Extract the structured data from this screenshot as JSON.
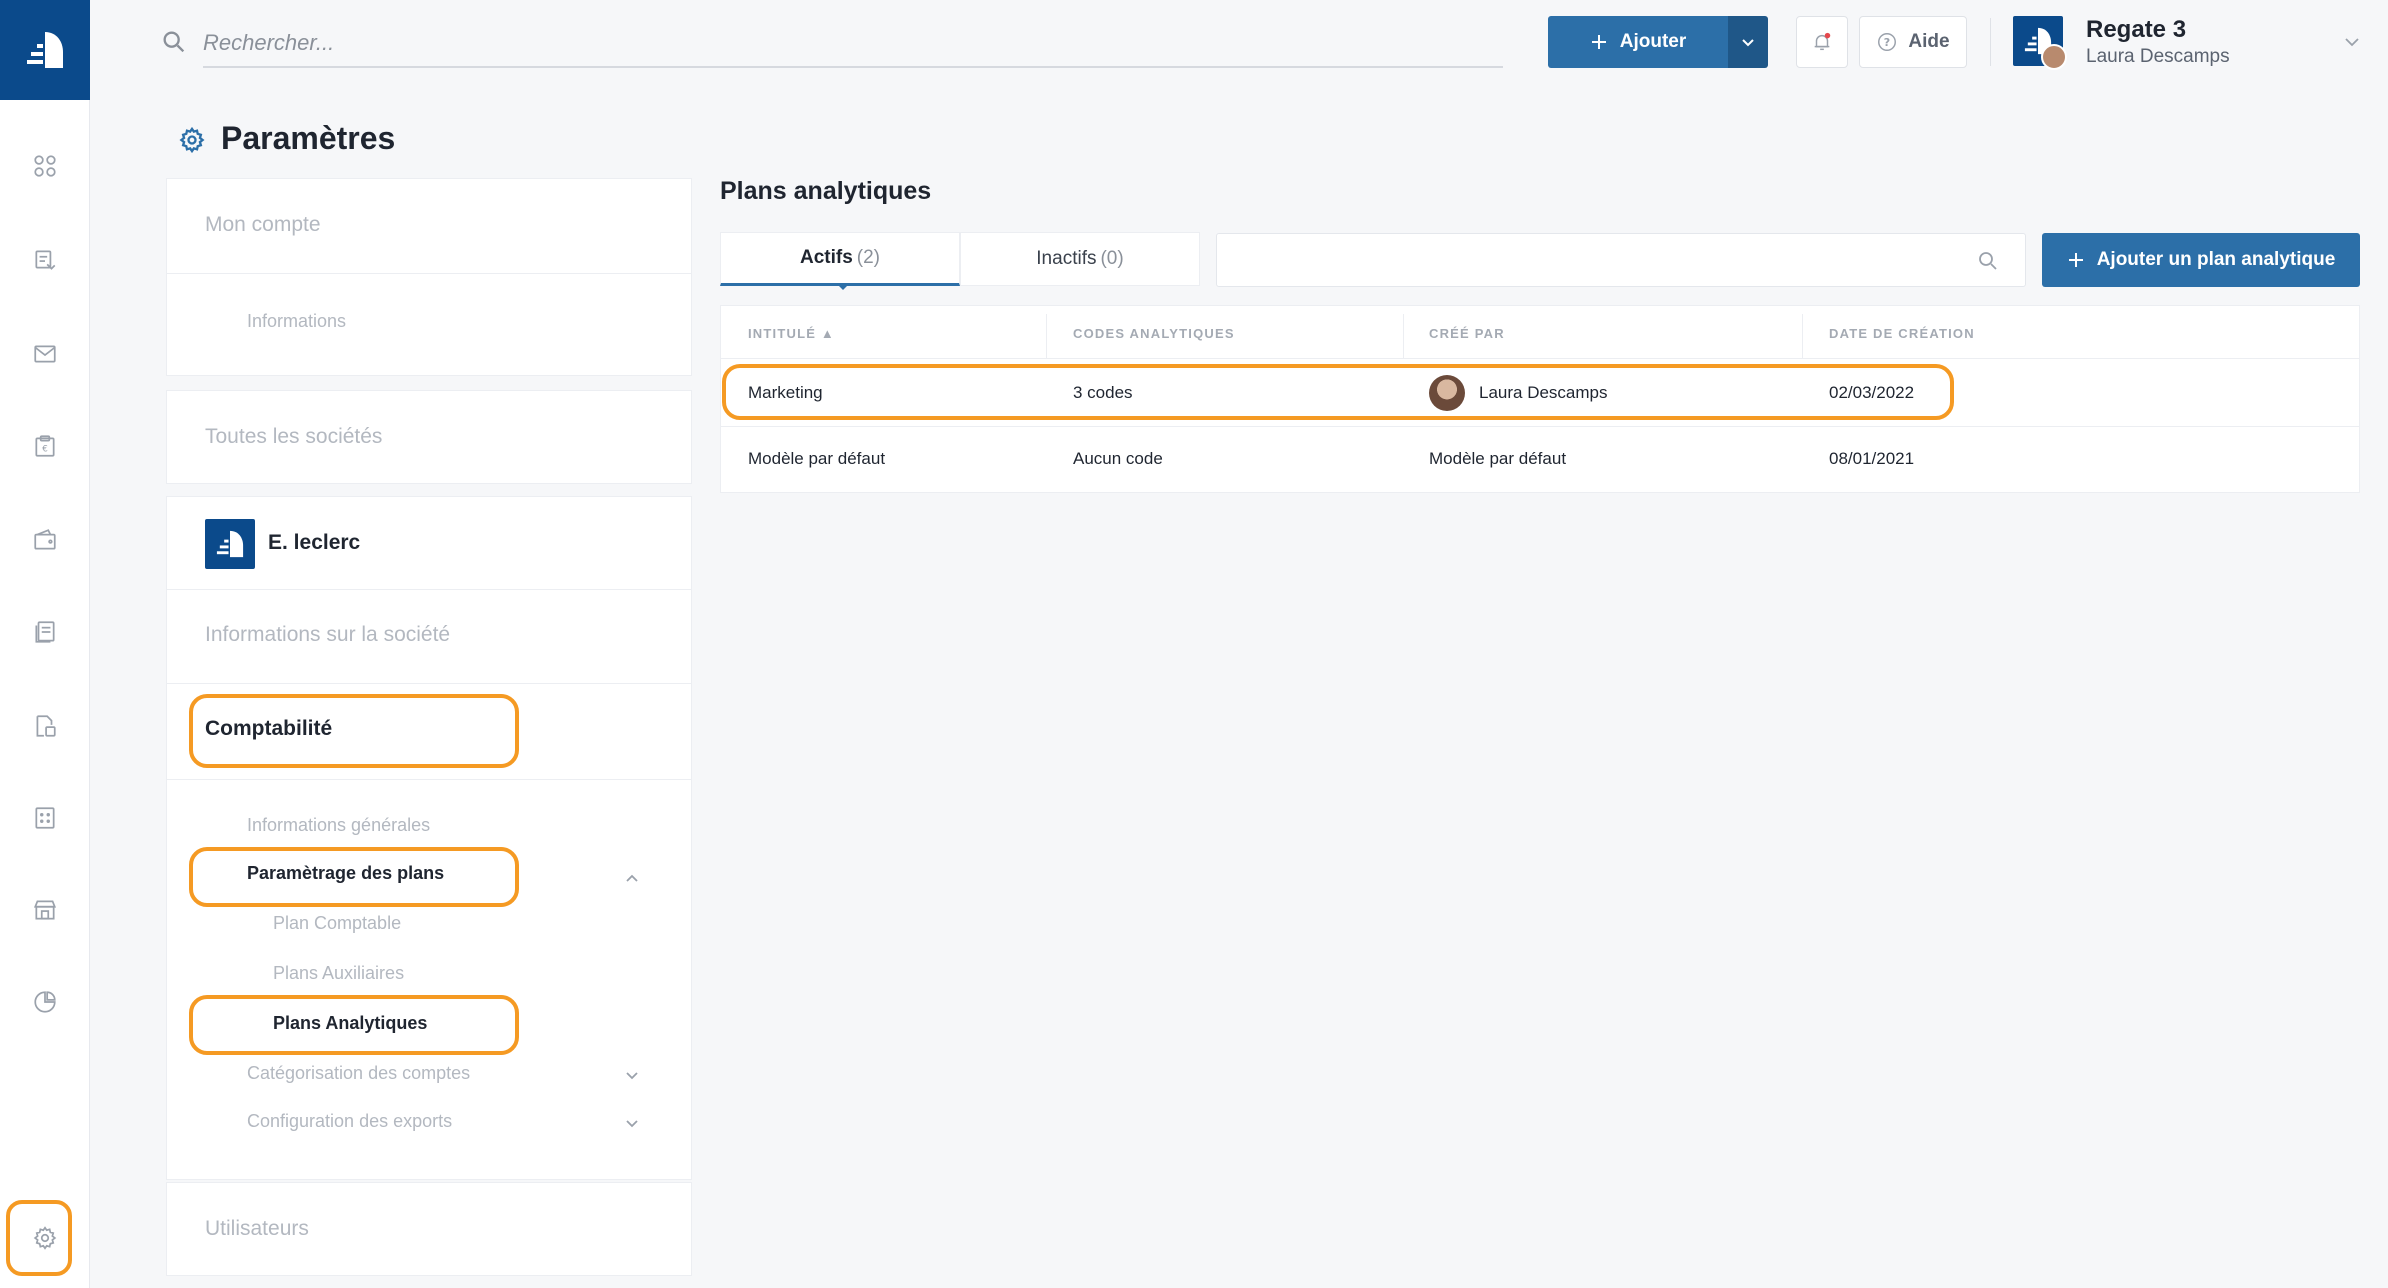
{
  "search": {
    "placeholder": "Rechercher..."
  },
  "header": {
    "add_label": "Ajouter",
    "help_label": "Aide",
    "company_name": "Regate 3",
    "user_name": "Laura Descamps"
  },
  "page": {
    "title": "Paramètres"
  },
  "sidebar": {
    "mon_compte": "Mon compte",
    "informations": "Informations",
    "toutes_societes": "Toutes les sociétés",
    "company": "E. leclerc",
    "infos_societe": "Informations sur la société",
    "comptabilite": "Comptabilité",
    "infos_generales": "Informations générales",
    "parametrage_plans": "Paramètrage des plans",
    "plan_comptable": "Plan Comptable",
    "plans_auxiliaires": "Plans Auxiliaires",
    "plans_analytiques": "Plans Analytiques",
    "categorisation": "Catégorisation des comptes",
    "configuration_exports": "Configuration des exports",
    "utilisateurs": "Utilisateurs"
  },
  "main": {
    "title": "Plans analytiques",
    "tabs": [
      {
        "label": "Actifs",
        "count": "(2)"
      },
      {
        "label": "Inactifs",
        "count": "(0)"
      }
    ],
    "add_plan_label": "Ajouter un plan analytique",
    "table": {
      "headers": [
        "INTITULÉ ▲",
        "CODES ANALYTIQUES",
        "CRÉÉ PAR",
        "DATE DE CRÉATION"
      ],
      "rows": [
        {
          "intitule": "Marketing",
          "codes": "3 codes",
          "cree_par": "Laura Descamps",
          "date": "02/03/2022"
        },
        {
          "intitule": "Modèle par défaut",
          "codes": "Aucun code",
          "cree_par": "Modèle par défaut",
          "date": "08/01/2021"
        }
      ]
    }
  },
  "colors": {
    "brand": "#0b4a8b",
    "primary": "#2c6fa8",
    "highlight": "#f59a23"
  }
}
